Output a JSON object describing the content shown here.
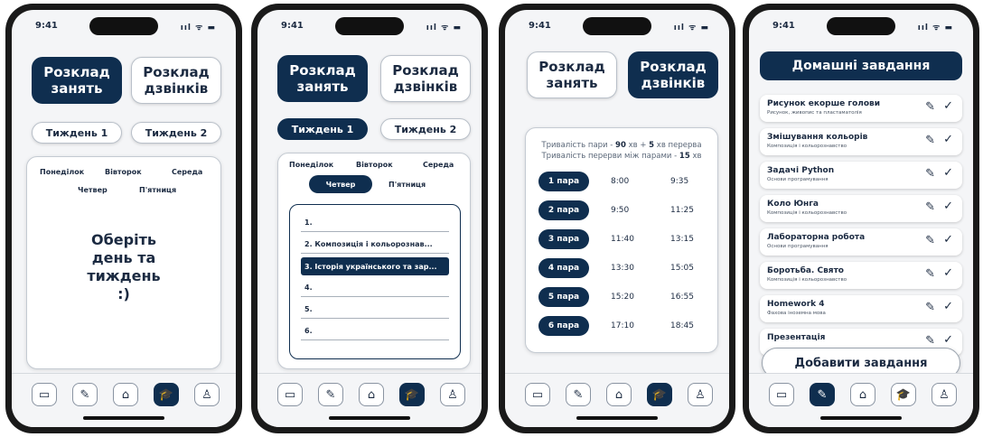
{
  "status": {
    "time": "9:41",
    "signal": "ııl ᯤ ▬"
  },
  "tabs": [
    "book-icon",
    "pencil-icon",
    "home-icon",
    "graduation-cap-icon",
    "user-icon"
  ],
  "tab_glyphs": [
    "▭",
    "✎",
    "⌂",
    "🎓",
    "♙"
  ],
  "screen1": {
    "schedule_btn": "Розклад\nзанять",
    "bells_btn": "Розклад\nдзвінків",
    "week1": "Тиждень 1",
    "week2": "Тиждень 2",
    "days": [
      "Понеділок",
      "Вівторок",
      "Середа",
      "Четвер",
      "П'ятниця"
    ],
    "prompt": "Оберіть\nдень та\nтиждень\n:)"
  },
  "screen2": {
    "schedule_btn": "Розклад\nзанять",
    "bells_btn": "Розклад\nдзвінків",
    "week1": "Тиждень 1",
    "week2": "Тиждень 2",
    "days": [
      "Понеділок",
      "Вівторок",
      "Середа",
      "Четвер",
      "П'ятниця"
    ],
    "lessons": [
      "1.",
      "2. Композиція і кольорознав...",
      "3. Історія українського та зар...",
      "4.",
      "5.",
      "6."
    ]
  },
  "screen3": {
    "schedule_btn": "Розклад\nзанять",
    "bells_btn": "Розклад\nдзвінків",
    "info_line1_prefix": "Тривалість пари - ",
    "info_line1_pair": "90",
    "info_line1_mid": " хв + ",
    "info_line1_break": "5",
    "info_line1_suffix": " хв перерва",
    "info_line2_prefix": "Тривалість перерви між парами - ",
    "info_line2_value": "15",
    "info_line2_suffix": " хв",
    "pairs": [
      {
        "label": "1 пара",
        "start": "8:00",
        "end": "9:35"
      },
      {
        "label": "2 пара",
        "start": "9:50",
        "end": "11:25"
      },
      {
        "label": "3 пара",
        "start": "11:40",
        "end": "13:15"
      },
      {
        "label": "4 пара",
        "start": "13:30",
        "end": "15:05"
      },
      {
        "label": "5 пара",
        "start": "15:20",
        "end": "16:55"
      },
      {
        "label": "6 пара",
        "start": "17:10",
        "end": "18:45"
      }
    ]
  },
  "screen4": {
    "title": "Домашні завдання",
    "tasks": [
      {
        "title": "Рисунок екорше голови",
        "subject": "Рисунок, живопис та пластаматолія"
      },
      {
        "title": "Змішування кольорів",
        "subject": "Композиція і кольорознавство"
      },
      {
        "title": "Задачі Python",
        "subject": "Основи програмування"
      },
      {
        "title": "Коло Юнга",
        "subject": "Композиція і кольорознавство"
      },
      {
        "title": "Лабораторна робота",
        "subject": "Основи програмування"
      },
      {
        "title": "Боротьба. Свято",
        "subject": "Композиція і кольорознавство"
      },
      {
        "title": "Homework 4",
        "subject": "Фахова іноземна мова"
      },
      {
        "title": "Презентація",
        "subject": ""
      }
    ],
    "add_button": "Добавити завдання"
  }
}
